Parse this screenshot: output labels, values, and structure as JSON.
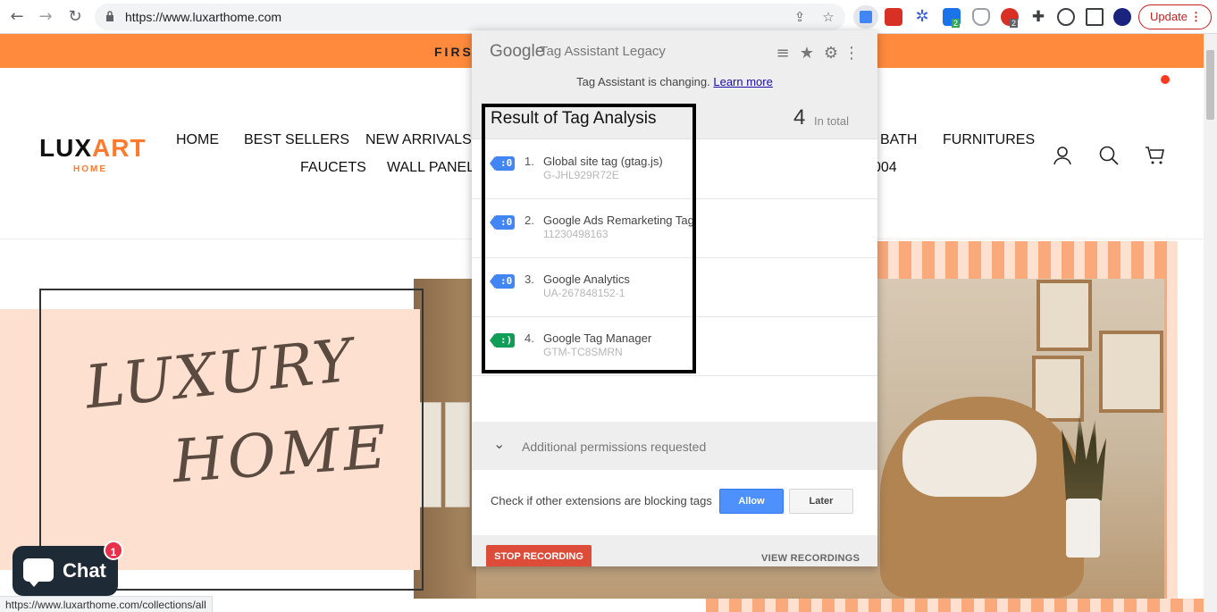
{
  "browser": {
    "url": "https://www.luxarthome.com",
    "update_label": "Update",
    "update_menu": "⋮",
    "ext_badge_a": "2",
    "ext_badge_b": "2"
  },
  "promo": {
    "text": "FIRST"
  },
  "site": {
    "logo_lux": "LUX",
    "logo_art": "ART",
    "logo_home": "HOME",
    "menu": {
      "home": "HOME",
      "best_sellers": "BEST SELLERS",
      "new_arrivals": "NEW ARRIVALS",
      "bath": "BATH",
      "furnitures": "FURNITURES",
      "faucets": "FAUCETS",
      "wall_panels": "WALL PANELS",
      "partial": "004"
    },
    "hero_line1": "LUXURY",
    "hero_line2": "HOME"
  },
  "chat": {
    "label": "Chat",
    "badge": "1"
  },
  "status_url": "https://www.luxarthome.com/collections/all",
  "popup": {
    "brand": "Google",
    "product": "Tag Assistant Legacy",
    "changing_text": "Tag Assistant is changing.",
    "learn_more": "Learn more",
    "result_title": "Result of Tag Analysis",
    "total_count": "4",
    "total_label": "In total",
    "tags": [
      {
        "num": "1.",
        "name": "Global site tag (gtag.js)",
        "id": "G-JHL929R72E",
        "color": "#4285f4"
      },
      {
        "num": "2.",
        "name": "Google Ads Remarketing Tag",
        "id": "11230498163",
        "color": "#4285f4"
      },
      {
        "num": "3.",
        "name": "Google Analytics",
        "id": "UA-267848152-1",
        "color": "#4285f4"
      },
      {
        "num": "4.",
        "name": "Google Tag Manager",
        "id": "GTM-TC8SMRN",
        "color": "#0f9d58"
      }
    ],
    "permissions_label": "Additional permissions requested",
    "check_text": "Check if other extensions are blocking tags",
    "allow_label": "Allow",
    "later_label": "Later",
    "stop_label": "STOP RECORDING",
    "view_label": "VIEW RECORDINGS"
  },
  "colors": {
    "accent_orange": "#ff8a3d",
    "tag_blue": "#4285f4",
    "tag_green": "#0f9d58",
    "stop_red": "#dd4b39",
    "allow_blue": "#4d90fe"
  }
}
